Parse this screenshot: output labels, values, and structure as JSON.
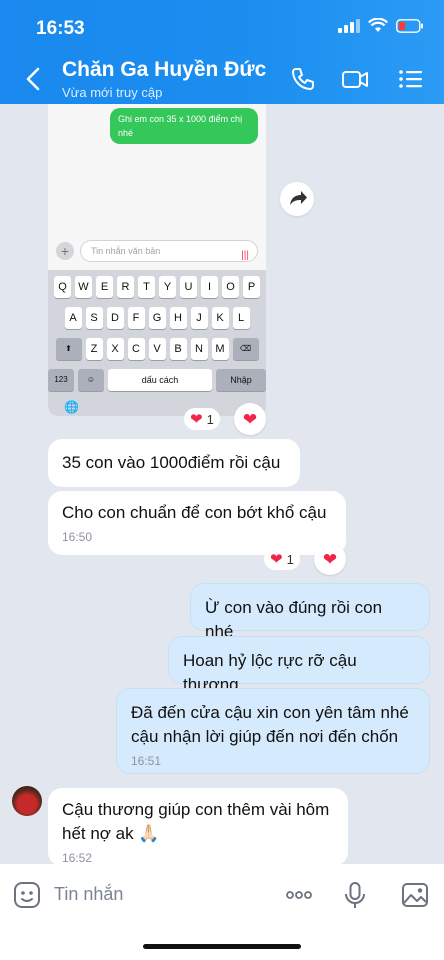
{
  "status": {
    "time": "16:53"
  },
  "header": {
    "title": "Chăn Ga Huyền Đức",
    "subtitle": "Vừa mới truy cập"
  },
  "embedded_screenshot": {
    "message": "Ghi em con 35 x 1000 điểm chị nhé",
    "input_placeholder": "Tin nhắn văn bản",
    "keyboard": {
      "row1": [
        "Q",
        "W",
        "E",
        "R",
        "T",
        "Y",
        "U",
        "I",
        "O",
        "P"
      ],
      "row2": [
        "A",
        "S",
        "D",
        "F",
        "G",
        "H",
        "J",
        "K",
        "L"
      ],
      "row3": [
        "Z",
        "X",
        "C",
        "V",
        "B",
        "N",
        "M"
      ],
      "numbers_key": "123",
      "space_key": "dấu cách",
      "enter_key": "Nhập"
    }
  },
  "reactions": [
    {
      "count": "1"
    },
    {
      "count": "1"
    }
  ],
  "messages": [
    {
      "direction": "in",
      "text": "35 con vào 1000điểm rồi cậu",
      "time": ""
    },
    {
      "direction": "in",
      "text": "Cho con chuẩn để con bớt khổ cậu",
      "time": "16:50"
    },
    {
      "direction": "out",
      "text": "Ừ con vào đúng rồi con nhé",
      "time": ""
    },
    {
      "direction": "out",
      "text": "Hoan hỷ lộc rực rỡ cậu thương",
      "time": ""
    },
    {
      "direction": "out",
      "text": "Đã đến cửa cậu xin con yên tâm nhé cậu nhận lời giúp đến nơi đến chốn",
      "time": "16:51"
    },
    {
      "direction": "in",
      "text": "Cậu thương giúp con thêm vài hôm hết nợ ak 🙏🏻",
      "time": "16:52"
    }
  ],
  "composer": {
    "placeholder": "Tin nhắn"
  },
  "colors": {
    "header": "#1c8ff0",
    "outgoing": "#d5ebfd",
    "heart": "#f0254a"
  }
}
